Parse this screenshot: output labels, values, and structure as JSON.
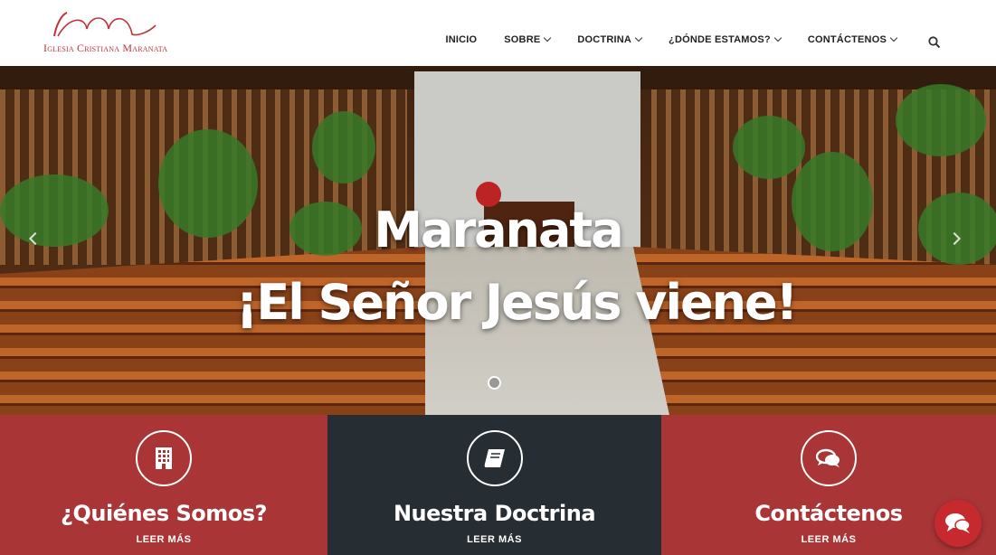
{
  "logo": {
    "text": "Iglesia Cristiana Maranata",
    "color": "#c0333a"
  },
  "nav": {
    "items": [
      {
        "label": "INICIO",
        "dropdown": false
      },
      {
        "label": "SOBRE",
        "dropdown": true
      },
      {
        "label": "DOCTRINA",
        "dropdown": true
      },
      {
        "label": "¿DÓNDE ESTAMOS?",
        "dropdown": true
      },
      {
        "label": "CONTÁCTENOS",
        "dropdown": true
      }
    ],
    "search_icon": "search-icon"
  },
  "hero": {
    "line1": "Maranata",
    "line2": "¡El Señor Jesús viene!",
    "slides": 1
  },
  "panels": [
    {
      "title": "¿Quiénes Somos?",
      "link": "LEER MÁS",
      "icon": "building-icon",
      "bg": "#a93537"
    },
    {
      "title": "Nuestra Doctrina",
      "link": "LEER MÁS",
      "icon": "book-icon",
      "bg": "#262d33"
    },
    {
      "title": "Contáctenos",
      "link": "LEER MÁS",
      "icon": "chat-bubbles-icon",
      "bg": "#a93537"
    }
  ],
  "chat_widget": {
    "icon": "chat-icon",
    "color": "#c62a2e"
  }
}
